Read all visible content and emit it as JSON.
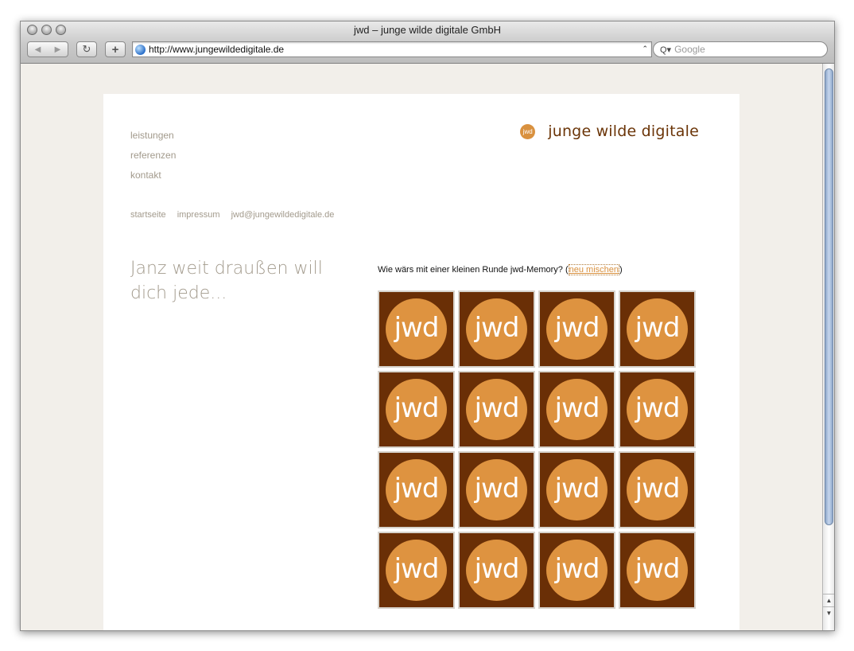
{
  "window": {
    "title": "jwd – junge wilde digitale GmbH"
  },
  "toolbar": {
    "back_glyph": "◀",
    "forward_glyph": "▶",
    "reload_glyph": "↻",
    "add_glyph": "+",
    "url": "http://www.jungewildedigitale.de",
    "search_placeholder": "Google",
    "search_icon": "Q▾"
  },
  "site": {
    "brand_logo_text": "jwd",
    "brand_name": "junge wilde digitale",
    "main_nav": [
      "leistungen",
      "referenzen",
      "kontakt"
    ],
    "sub_nav": [
      "startseite",
      "impressum",
      "jwd@jungewildedigitale.de"
    ],
    "tagline": "Janz weit draußen will dich jede...",
    "memory": {
      "prompt": "Wie wärs mit einer kleinen Runde jwd-Memory? (",
      "shuffle_link": "neu mischen",
      "closing": ")",
      "card_label": "jwd"
    }
  },
  "colors": {
    "card_bg": "#6a2f06",
    "card_circle": "#de9340",
    "brand_text": "#6b3508",
    "nav_text": "#a29a8c"
  }
}
